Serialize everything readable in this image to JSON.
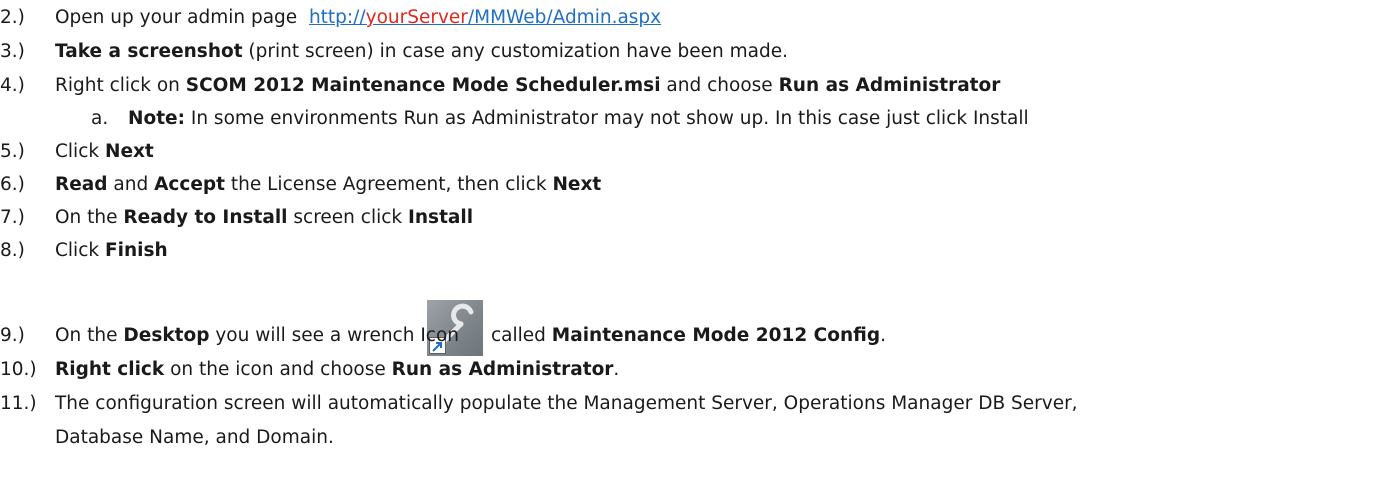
{
  "steps": {
    "s2": {
      "num": "2.)",
      "text": "Open up your admin page",
      "link_a": "http://",
      "link_b": "yourServer",
      "link_c": "/MMWeb/Admin.aspx"
    },
    "s3": {
      "num": "3.)",
      "b1": "Take a screenshot",
      "t1": " (print screen) in case any customization have been made."
    },
    "s4": {
      "num": "4.)",
      "t1": "Right click on ",
      "b1": "SCOM 2012 Maintenance Mode Scheduler.msi",
      "t2": " and choose ",
      "b2": "Run as Administrator"
    },
    "s4a": {
      "num": "a.",
      "b1": "Note:",
      "t1": " In some environments Run as Administrator may not show up. In this case just click Install"
    },
    "s5": {
      "num": "5.)",
      "t1": "Click ",
      "b1": "Next"
    },
    "s6": {
      "num": "6.)",
      "b1": "Read",
      "t1": " and ",
      "b2": "Accept",
      "t2": " the License Agreement, then click ",
      "b3": "Next"
    },
    "s7": {
      "num": "7.)",
      "t1": "On the ",
      "b1": "Ready to Install",
      "t2": " screen click ",
      "b2": "Install"
    },
    "s8": {
      "num": "8.)",
      "t1": "Click ",
      "b1": "Finish"
    },
    "s9": {
      "num": "9.)",
      "t1": "On the ",
      "b1": "Desktop",
      "t2": " you will see a wrench Icon",
      "t3": "called ",
      "b2": "Maintenance Mode 2012 Config",
      "t4": "."
    },
    "s10": {
      "num": "10.)",
      "b1": "Right click",
      "t1": " on the icon and choose ",
      "b2": "Run as Administrator",
      "t2": "."
    },
    "s11": {
      "num": "11.)",
      "t1": "The configuration screen will automatically populate the Management Server, Operations Manager DB Server,",
      "t2": "Database Name, and Domain."
    }
  },
  "icons": {
    "wrench": "wrench-icon"
  }
}
